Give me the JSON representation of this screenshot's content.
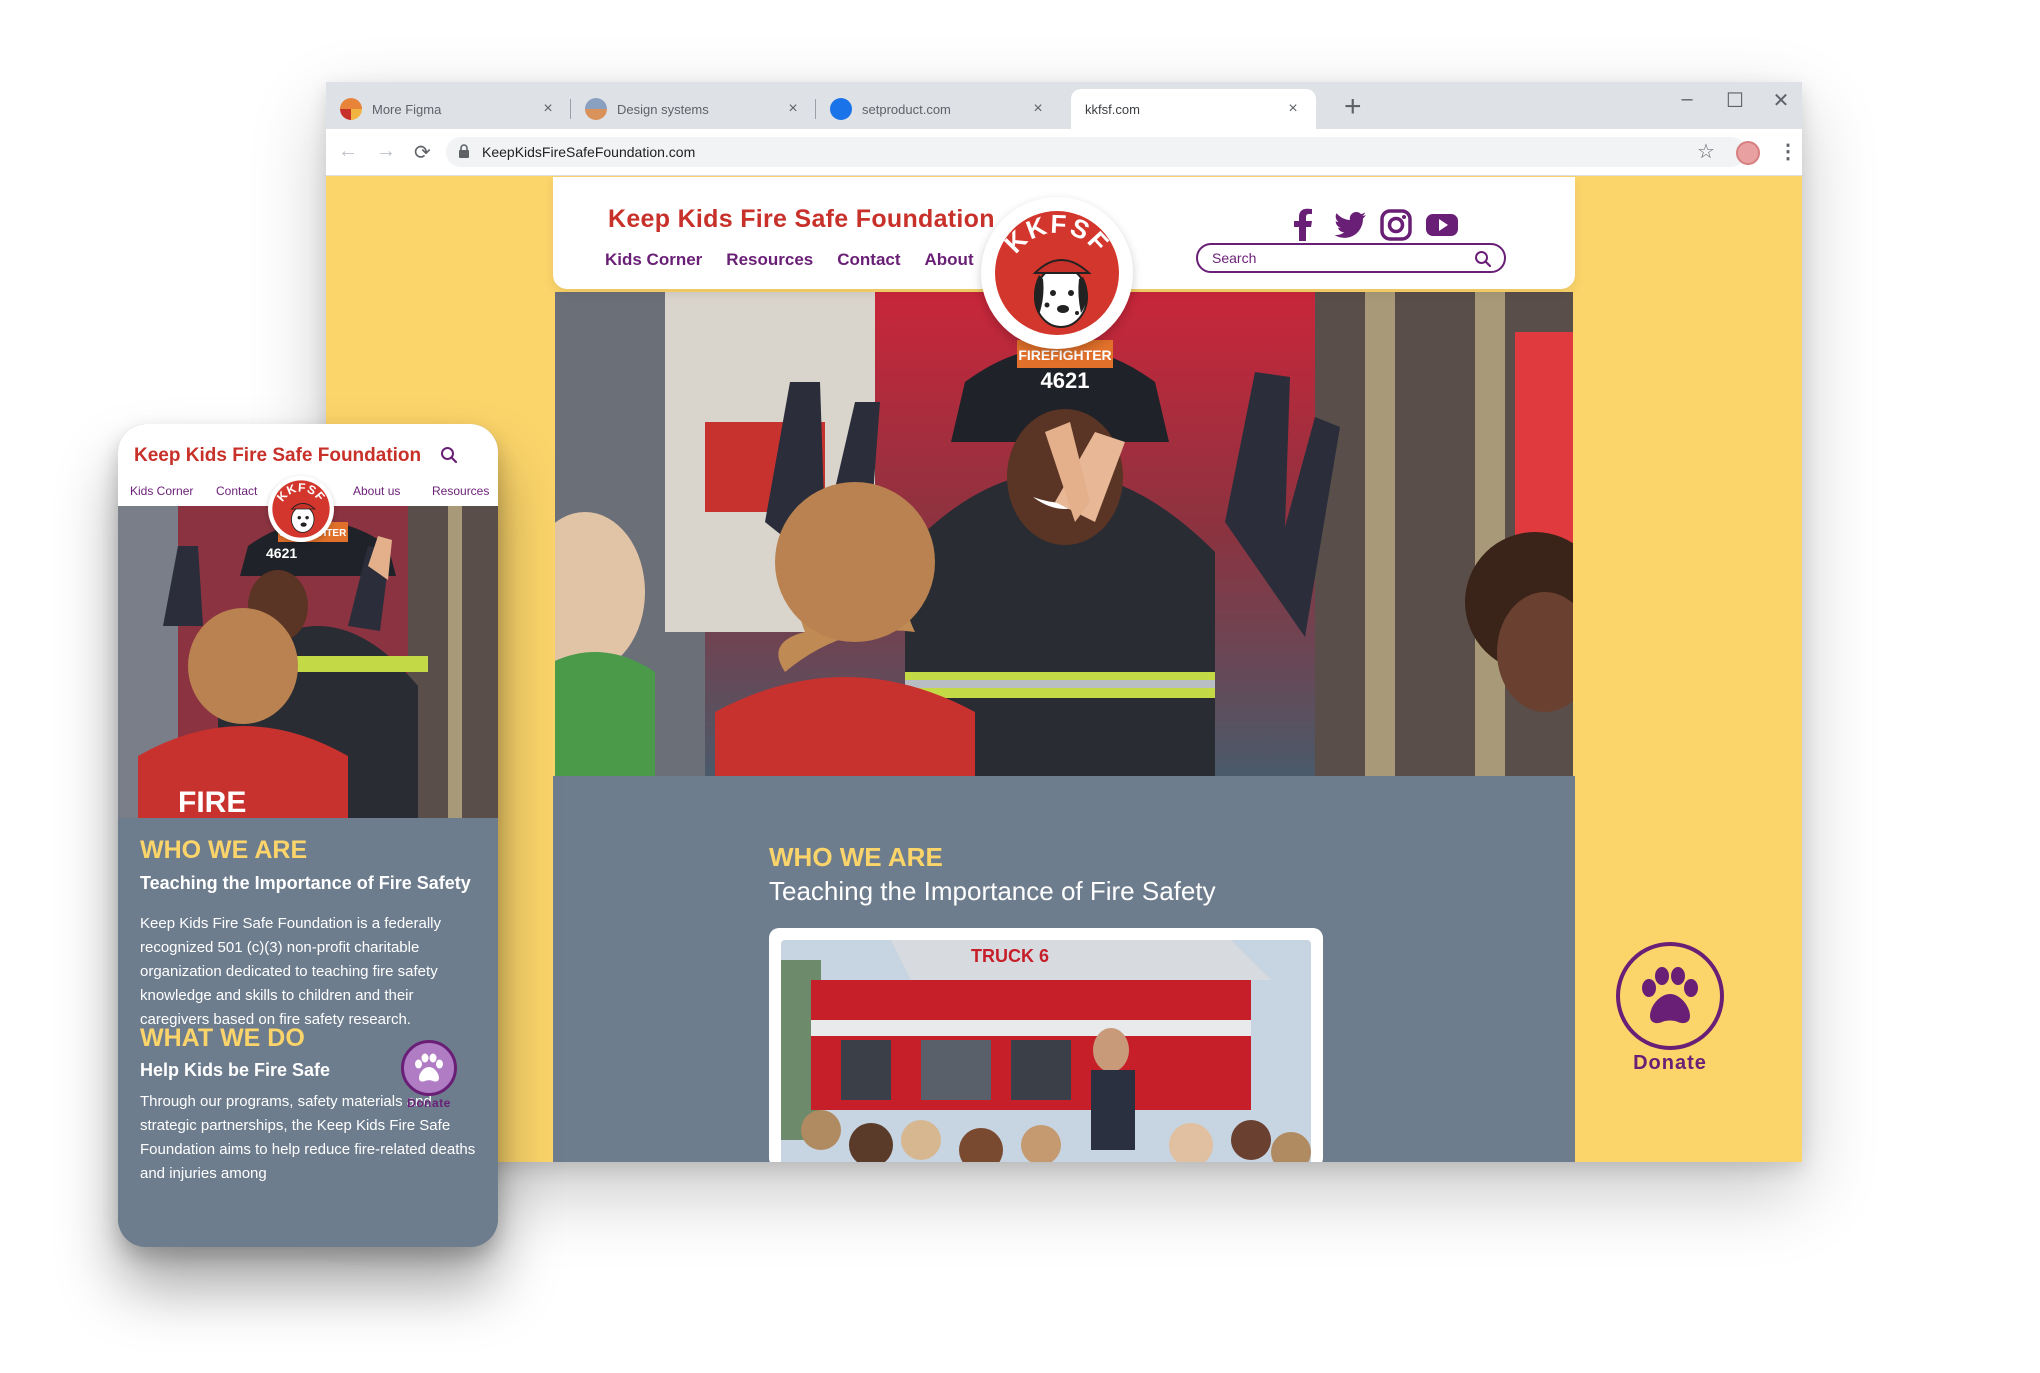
{
  "browser": {
    "tabs": [
      {
        "label": "More Figma",
        "favicon_color": "#e8833a"
      },
      {
        "label": "Design systems",
        "favicon_color": "#8aa0c0"
      },
      {
        "label": "setproduct.com",
        "favicon_color": "#1a73e8"
      },
      {
        "label": "kkfsf.com",
        "favicon_color": "",
        "active": true
      }
    ],
    "url": "KeepKidsFireSafeFoundation.com"
  },
  "site": {
    "title": "Keep Kids Fire Safe Foundation",
    "logo_text": "KKFSF",
    "nav": [
      "Kids Corner",
      "Resources",
      "Contact",
      "About"
    ],
    "social_icons": [
      "facebook-icon",
      "twitter-icon",
      "instagram-icon",
      "youtube-icon"
    ],
    "search_placeholder": "Search",
    "hero_badge": "FIREFIGHTER",
    "hero_number": "4621",
    "section_title": "WHO WE ARE",
    "section_subtitle": "Teaching the Importance of Fire Safety",
    "card_truck_text": "TRUCK 6",
    "donate_label": "Donate"
  },
  "mobile": {
    "title": "Keep Kids Fire Safe Foundation",
    "nav": [
      "Kids Corner",
      "Contact",
      "About us",
      "Resources"
    ],
    "hero_badge": "FIREFIGHTER",
    "hero_number": "4621",
    "shirt_text": "FIRE",
    "who_title": "WHO WE ARE",
    "who_subtitle": "Teaching the Importance of Fire Safety",
    "who_body": "Keep Kids Fire Safe Foundation is a federally recognized 501 (c)(3) non-profit charitable organization dedicated to teaching fire safety knowledge and skills to children and their caregivers based on fire safety research.",
    "what_title": "WHAT WE DO",
    "what_subtitle": "Help Kids be Fire Safe",
    "what_body": "Through our programs, safety materials and strategic partnerships, the Keep Kids Fire Safe Foundation aims to help reduce fire-related deaths and injuries among",
    "donate_label": "Donate"
  },
  "colors": {
    "brand_red": "#c8302a",
    "brand_purple": "#6a1f76",
    "brand_yellow": "#fbd46a",
    "section_gray": "#6e7d8e"
  }
}
